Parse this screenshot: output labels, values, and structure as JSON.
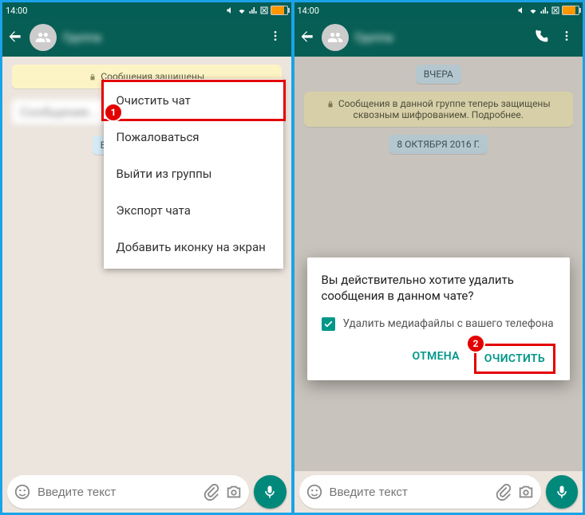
{
  "status": {
    "time": "14:00"
  },
  "colors": {
    "accent": "#009688",
    "danger": "#e30000",
    "header": "#075e54"
  },
  "left": {
    "title": "Группа",
    "encryption_msg": "Сообщения защищены",
    "input_placeholder": "Введите текст",
    "added_chip": "Вы были добавлены",
    "menu": {
      "items": [
        {
          "label": "Очистить чат",
          "highlight": true
        },
        {
          "label": "Пожаловаться"
        },
        {
          "label": "Выйти из группы"
        },
        {
          "label": "Экспорт чата"
        },
        {
          "label": "Добавить иконку на экран"
        }
      ]
    },
    "marker": "1"
  },
  "right": {
    "title": "Группа",
    "yesterday_chip": "ВЧЕРА",
    "encryption_msg": "Сообщения в данной группе теперь защищены сквозным шифрованием. Подробнее.",
    "date_chip": "8 ОКТЯБРЯ 2016 Г.",
    "input_placeholder": "Введите текст",
    "dialog": {
      "title": "Вы действительно хотите удалить сообщения в данном чате?",
      "checkbox_label": "Удалить медиафайлы с вашего телефона",
      "cancel": "ОТМЕНА",
      "confirm": "ОЧИСТИТЬ"
    },
    "marker": "2"
  }
}
